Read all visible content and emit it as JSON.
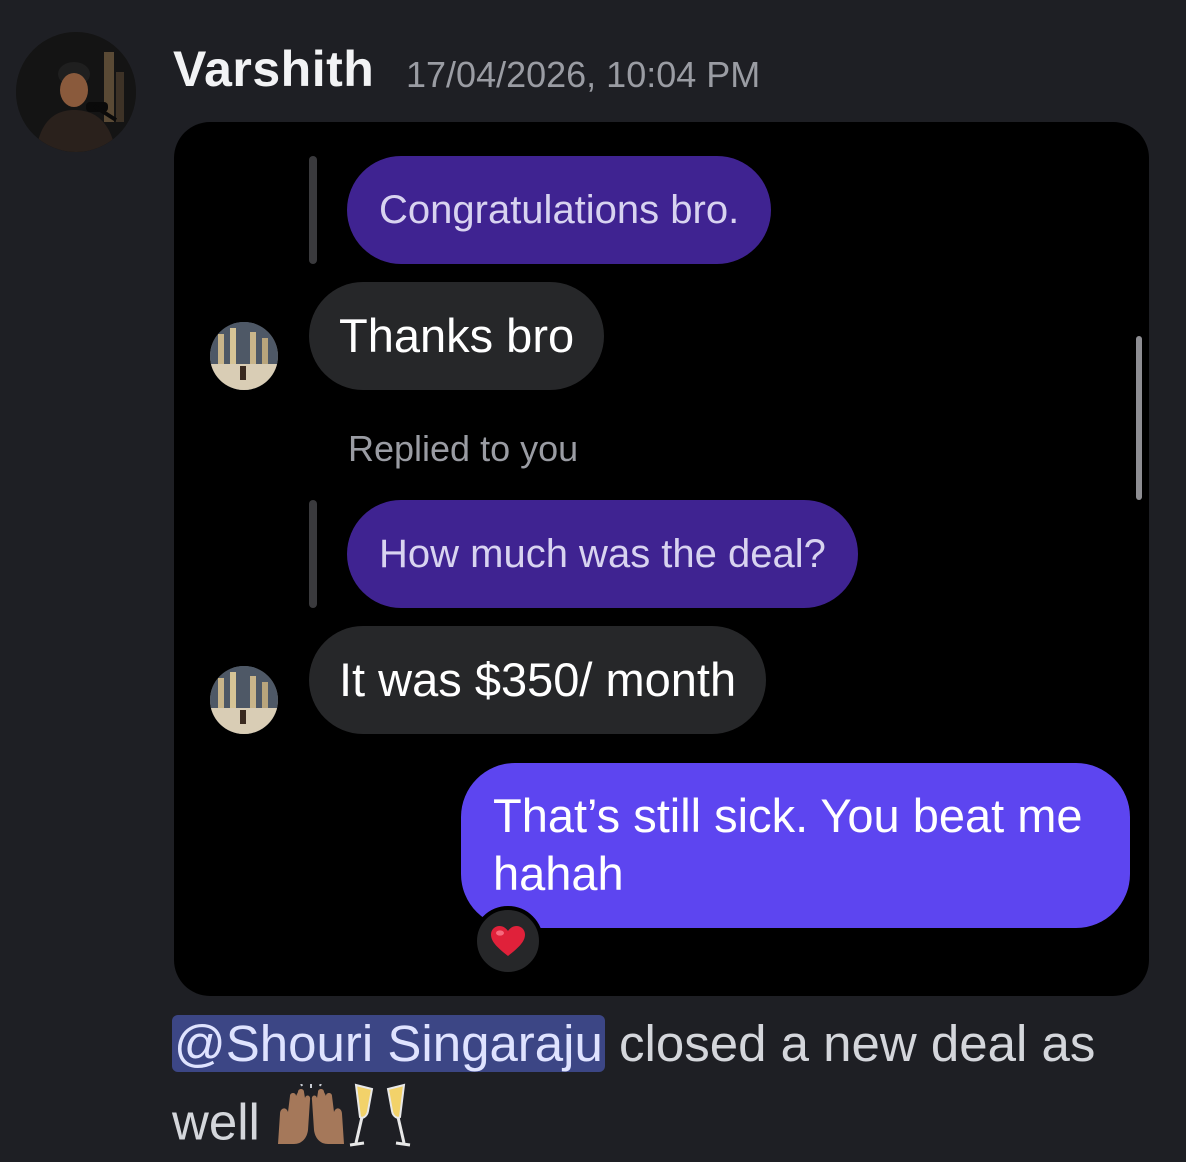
{
  "message": {
    "author": "Varshith",
    "timestamp": "17/04/2026, 10:04 PM",
    "mention": "@Shouri Singaraju",
    "text": " closed a new deal as well",
    "emojis": [
      "raising-hands-icon",
      "champagne-glasses-icon"
    ]
  },
  "screenshot": {
    "conversation": [
      {
        "type": "quoted",
        "text": "Congratulations bro."
      },
      {
        "type": "theirs",
        "text": "Thanks bro"
      },
      {
        "type": "reply_label",
        "text": "Replied to you"
      },
      {
        "type": "quoted",
        "text": "How much was the deal?"
      },
      {
        "type": "theirs",
        "text": "It was $350/ month"
      },
      {
        "type": "mine",
        "text": "That’s still sick. You beat me hahah"
      }
    ],
    "reaction": "heart-icon"
  },
  "colors": {
    "background": "#1e1f24",
    "card": "#000000",
    "quoted_bubble": "#3f2391",
    "incoming_bubble": "#262729",
    "outgoing_bubble": "#5d45f0",
    "mention_bg": "#3c4685"
  }
}
